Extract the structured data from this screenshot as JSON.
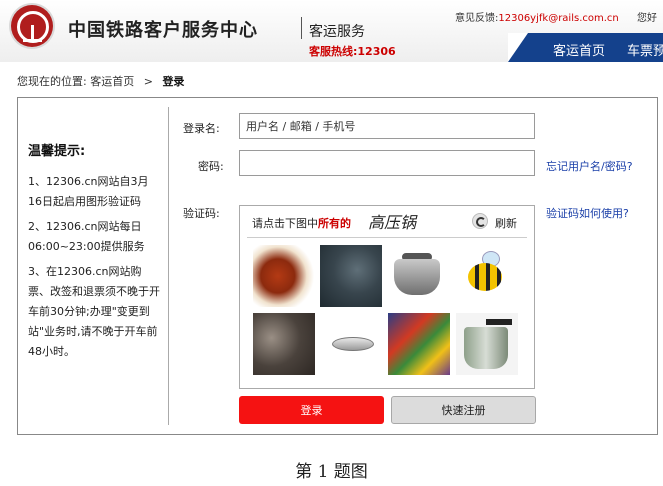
{
  "header": {
    "site_title": "中国铁路客户服务中心",
    "sub_title": "客运服务",
    "hotline": "客服热线:12306",
    "feedback_label": "意见反馈:",
    "feedback_email": "12306yjfk@rails.com.cn",
    "greeting": "您好"
  },
  "nav": {
    "items": [
      {
        "label": "客运首页"
      },
      {
        "label": "车票预"
      }
    ]
  },
  "breadcrumb": {
    "prefix": "您现在的位置:",
    "parent": "客运首页",
    "separator": ">",
    "current": "登录"
  },
  "tips": {
    "title": "温馨提示:",
    "items": [
      {
        "text": "1、12306.cn网站自3月16日起启用图形验证码"
      },
      {
        "text": "2、12306.cn网站每日06:00~23:00提供服务"
      },
      {
        "text": "3、在12306.cn网站购票、改签和退票须不晚于开车前30分钟;办理\"变更到站\"业务时,请不晚于开车前48小时。"
      }
    ]
  },
  "form": {
    "username_label": "登录名:",
    "username_placeholder": "用户名 / 邮箱 / 手机号",
    "password_label": "密码:",
    "password_value": "",
    "captcha_label": "验证码:",
    "forgot_link": "忘记用户名/密码?",
    "captcha_help_link": "验证码如何使用?"
  },
  "captcha": {
    "instruction_prefix": "请点击下图中",
    "instruction_emphasis": "所有的",
    "target_word": "高压锅",
    "refresh_label": "刷新",
    "tiles": [
      {
        "icon": "chili-dish-image"
      },
      {
        "icon": "dark-texture-image"
      },
      {
        "icon": "pressure-cooker-image"
      },
      {
        "icon": "bee-cartoon-image"
      },
      {
        "icon": "dark-stone-image"
      },
      {
        "icon": "dish-plate-image"
      },
      {
        "icon": "colorful-paint-image"
      },
      {
        "icon": "pressure-cooker-image"
      }
    ]
  },
  "buttons": {
    "login_label": "登录",
    "register_label": "快速注册"
  },
  "caption": "第 1 题图",
  "colors": {
    "nav_background": "#14418c",
    "login_button": "#f51212",
    "accent_red": "#cc0000",
    "link_blue": "#1a3fa8"
  }
}
